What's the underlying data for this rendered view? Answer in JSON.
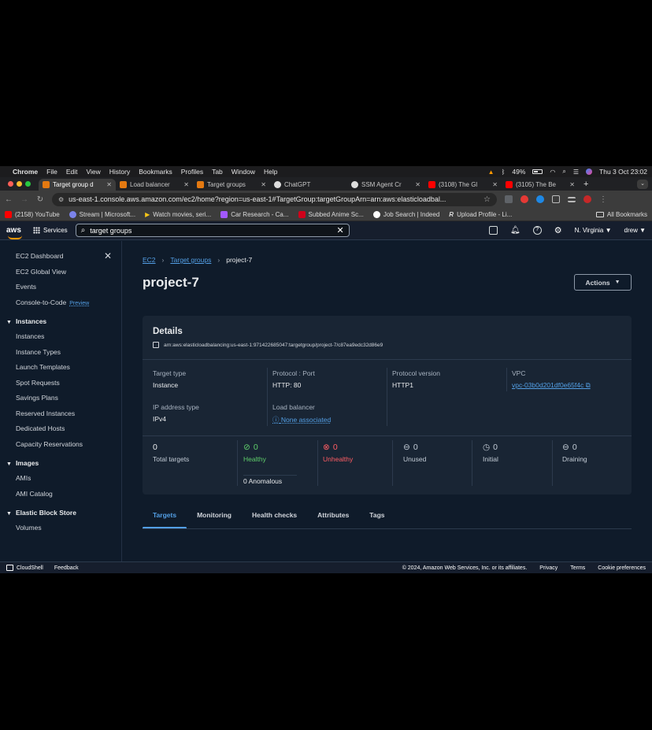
{
  "menubar": {
    "items": [
      "Chrome",
      "File",
      "Edit",
      "View",
      "History",
      "Bookmarks",
      "Profiles",
      "Tab",
      "Window",
      "Help"
    ],
    "battery": "49%",
    "datetime": "Thu 3 Oct  23:02"
  },
  "tabs": [
    {
      "label": "Target group d",
      "favicon_color": "#e47911",
      "active": true
    },
    {
      "label": "Load balancer",
      "favicon_color": "#e47911",
      "active": false
    },
    {
      "label": "Target groups",
      "favicon_color": "#e47911",
      "active": false
    },
    {
      "label": "ChatGPT",
      "favicon_color": "#dddddd",
      "active": false
    },
    {
      "label": "SSM Agent Cr",
      "favicon_color": "#dddddd",
      "active": false
    },
    {
      "label": "(3108) The Gl",
      "favicon_color": "#ff0000",
      "active": false
    },
    {
      "label": "(3105) The Be",
      "favicon_color": "#ff0000",
      "active": false
    }
  ],
  "address": {
    "url": "us-east-1.console.aws.amazon.com/ec2/home?region=us-east-1#TargetGroup:targetGroupArn=arn:aws:elasticloadbal..."
  },
  "bookmarks": [
    {
      "label": "(2158) YouTube",
      "color": "#ff0000"
    },
    {
      "label": "Stream | Microsoft...",
      "color": "#7b83eb"
    },
    {
      "label": "Watch movies, seri...",
      "color": "#f5c518"
    },
    {
      "label": "Car Research - Ca...",
      "color": "#a259ff"
    },
    {
      "label": "Subbed Anime Sc...",
      "color": "#d0021b"
    },
    {
      "label": "Job Search | Indeed",
      "color": "#ffffff"
    },
    {
      "label": "Upload Profile - Li...",
      "color": "#ffffff"
    }
  ],
  "bookmarks_all": "All Bookmarks",
  "awsnav": {
    "logo": "aws",
    "services": "Services",
    "search_value": "target groups",
    "region": "N. Virginia ▼",
    "user": "drew ▼"
  },
  "sidebar": {
    "top_items": [
      "EC2 Dashboard",
      "EC2 Global View",
      "Events"
    ],
    "console_to_code": "Console-to-Code",
    "preview": "Preview",
    "sections": [
      {
        "title": "Instances",
        "items": [
          "Instances",
          "Instance Types",
          "Launch Templates",
          "Spot Requests",
          "Savings Plans",
          "Reserved Instances",
          "Dedicated Hosts",
          "Capacity Reservations"
        ]
      },
      {
        "title": "Images",
        "items": [
          "AMIs",
          "AMI Catalog"
        ]
      },
      {
        "title": "Elastic Block Store",
        "items": [
          "Volumes"
        ]
      }
    ]
  },
  "breadcrumb": {
    "ec2": "EC2",
    "target_groups": "Target groups",
    "current": "project-7"
  },
  "page_title": "project-7",
  "actions_label": "Actions",
  "details": {
    "heading": "Details",
    "arn": "arn:aws:elasticloadbalancing:us-east-1:971422685047:targetgroup/project-7/c87ea9edc32d86e9",
    "target_type": {
      "k": "Target type",
      "v": "Instance"
    },
    "protocol_port": {
      "k": "Protocol : Port",
      "v": "HTTP: 80"
    },
    "protocol_version": {
      "k": "Protocol version",
      "v": "HTTP1"
    },
    "vpc": {
      "k": "VPC",
      "v": "vpc-03b0d201df0e65f4c"
    },
    "ip_type": {
      "k": "IP address type",
      "v": "IPv4"
    },
    "load_balancer": {
      "k": "Load balancer",
      "v": "None associated"
    }
  },
  "stats": {
    "total": {
      "num": "0",
      "label": "Total targets"
    },
    "healthy": {
      "num": "0",
      "label": "Healthy"
    },
    "anomalous": "0 Anomalous",
    "unhealthy": {
      "num": "0",
      "label": "Unhealthy"
    },
    "unused": {
      "num": "0",
      "label": "Unused"
    },
    "initial": {
      "num": "0",
      "label": "Initial"
    },
    "draining": {
      "num": "0",
      "label": "Draining"
    }
  },
  "detail_tabs": [
    "Targets",
    "Monitoring",
    "Health checks",
    "Attributes",
    "Tags"
  ],
  "footer": {
    "cloudshell": "CloudShell",
    "feedback": "Feedback",
    "copyright": "© 2024, Amazon Web Services, Inc. or its affiliates.",
    "privacy": "Privacy",
    "terms": "Terms",
    "cookies": "Cookie preferences"
  }
}
